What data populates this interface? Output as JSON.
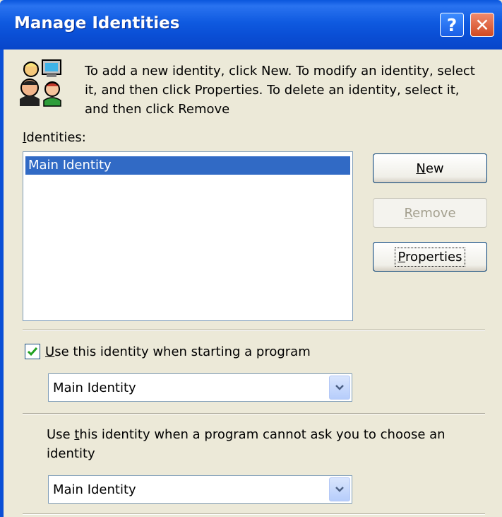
{
  "window": {
    "title": "Manage Identities",
    "help_glyph": "?",
    "close_glyph": "✕"
  },
  "intro": {
    "text": "To add a new identity, click New.  To modify an identity, select it, and then click Properties.  To delete an identity, select it, and then click Remove"
  },
  "identities": {
    "label_accel": "I",
    "label_rest": "dentities:",
    "items": [
      "Main Identity"
    ],
    "selected_index": 0
  },
  "buttons": {
    "new": {
      "accel": "N",
      "rest": "ew"
    },
    "remove": {
      "accel": "R",
      "rest": "emove",
      "enabled": false
    },
    "properties": {
      "accel": "P",
      "rest": "roperties"
    }
  },
  "startup": {
    "checked": true,
    "label_accel": "U",
    "label_rest": "se this identity when starting a program",
    "selected": "Main Identity"
  },
  "default_identity": {
    "label_pre": "Use ",
    "label_accel": "t",
    "label_rest": "his identity when a program cannot ask you to choose an identity",
    "selected": "Main Identity"
  },
  "icons": {
    "title_help": "help-icon",
    "title_close": "close-icon",
    "dialog": "people-computer-icon",
    "check": "checkmark-icon",
    "dropdown": "chevron-down-icon"
  },
  "colors": {
    "titlebar": "#0a4fd6",
    "selection": "#316ac5",
    "face": "#ece9d8"
  }
}
